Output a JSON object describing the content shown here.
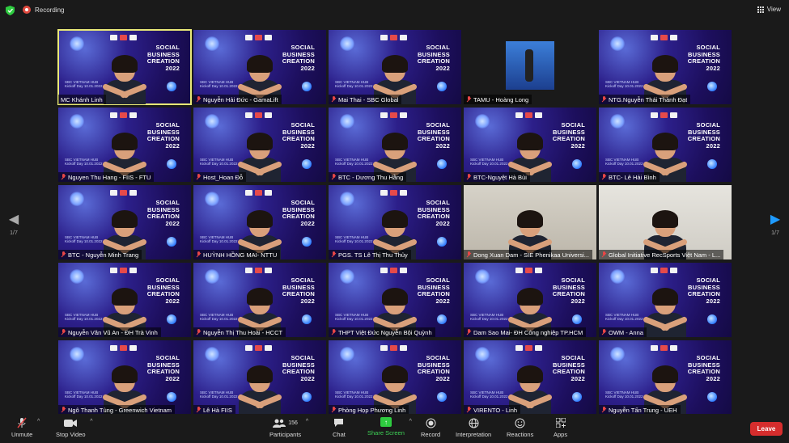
{
  "topbar": {
    "recording_label": "Recording",
    "view_label": "View"
  },
  "pagination": {
    "left_page": "1/7",
    "right_page": "1/7"
  },
  "tile_text": {
    "banner_line1": "SOCIAL",
    "banner_line2": "BUSINESS",
    "banner_line3": "CREATION",
    "banner_line4": "2022",
    "hub_line1": "SBC VIETNAM HUB",
    "hub_line2": "Kickoff Day 10.01.2022"
  },
  "participants": [
    {
      "name": "MC Khánh Linh",
      "muted": false
    },
    {
      "name": "Nguyễn Hải Đức - GamaLift",
      "muted": true
    },
    {
      "name": "Mai Thai - SBC Global",
      "muted": true
    },
    {
      "name": "TAMU - Hoàng Long",
      "muted": true
    },
    {
      "name": "NTG.Nguyễn Thái Thành Đạt",
      "muted": true
    },
    {
      "name": "Nguyen Thu Hang - FIIS - FTU",
      "muted": true
    },
    {
      "name": "Host_Hoan Đỗ",
      "muted": true
    },
    {
      "name": "BTC - Dương Thu Hằng",
      "muted": true
    },
    {
      "name": "BTC-Nguyệt Hà Bùi",
      "muted": true
    },
    {
      "name": "BTC- Lê Hải Bình",
      "muted": true
    },
    {
      "name": "BTC - Nguyễn Minh Trang",
      "muted": true
    },
    {
      "name": "HUỲNH HỒNG MAI- NTTU",
      "muted": true
    },
    {
      "name": "PGS. TS Lê Thị Thu Thủy",
      "muted": true
    },
    {
      "name": "Dong Xuan Dam - SIE Phenikaa Universi...",
      "muted": true
    },
    {
      "name": "Global Initiative RecSports Việt Nam - L...",
      "muted": true
    },
    {
      "name": "Nguyễn Văn Vũ An - ĐH Trà Vinh",
      "muted": true
    },
    {
      "name": "Nguyễn Thị Thu Hoài - HCCT",
      "muted": true
    },
    {
      "name": "THPT Việt Đức Nguyễn Bội Quỳnh",
      "muted": true
    },
    {
      "name": "Dam Sao Mai- ĐH Công nghiệp TP.HCM",
      "muted": true
    },
    {
      "name": "OWM - Anna",
      "muted": true
    },
    {
      "name": "Ngô Thanh Tùng - Greenwich Vietnam",
      "muted": true
    },
    {
      "name": "Lê Hà FIIS",
      "muted": true
    },
    {
      "name": "Phòng Họp Phương Linh",
      "muted": true
    },
    {
      "name": "VIRENTO - Linh",
      "muted": true
    },
    {
      "name": "Nguyễn Tấn Trung - UEH",
      "muted": true
    }
  ],
  "toolbar": {
    "unmute": "Unmute",
    "stop_video": "Stop Video",
    "participants": "Participants",
    "participants_count": "156",
    "chat": "Chat",
    "share_screen": "Share Screen",
    "record": "Record",
    "interpretation": "Interpretation",
    "reactions": "Reactions",
    "apps": "Apps",
    "leave": "Leave"
  },
  "colors": {
    "active_speaker_border": "#e8e877",
    "share_green": "#2ecc40",
    "leave_red": "#d62d2d",
    "nav_blue": "#1e9bff"
  }
}
